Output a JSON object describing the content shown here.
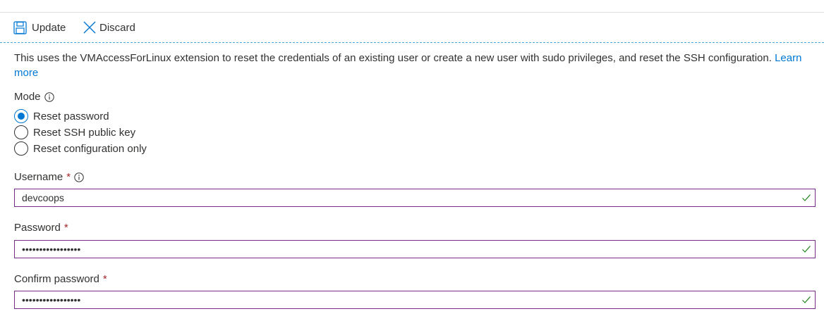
{
  "toolbar": {
    "update_label": "Update",
    "discard_label": "Discard",
    "update_icon": "save-icon",
    "discard_icon": "close-icon"
  },
  "description": {
    "text": "This uses the VMAccessForLinux extension to reset the credentials of an existing user or create a new user with sudo privileges, and reset the SSH configuration. ",
    "link": "Learn more"
  },
  "mode": {
    "label": "Mode",
    "options": [
      {
        "label": "Reset password",
        "selected": true
      },
      {
        "label": "Reset SSH public key",
        "selected": false
      },
      {
        "label": "Reset configuration only",
        "selected": false
      }
    ]
  },
  "username": {
    "label": "Username",
    "required_mark": "*",
    "value": "devcoops"
  },
  "password": {
    "label": "Password",
    "required_mark": "*",
    "value": "•••••••••••••••••"
  },
  "confirm_password": {
    "label": "Confirm password",
    "required_mark": "*",
    "value": "•••••••••••••••••"
  },
  "colors": {
    "accent": "#0078d4",
    "required": "#a4262c",
    "input_border": "#7a2a8c",
    "valid_check": "#107c10",
    "dashed_rule": "#45a6d8"
  }
}
